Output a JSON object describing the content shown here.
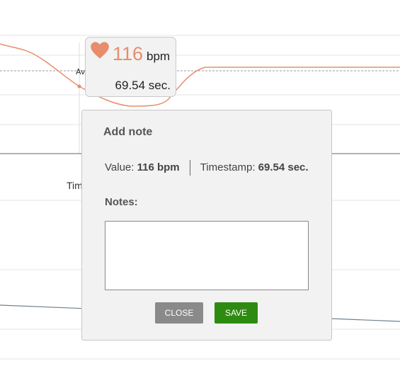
{
  "chart": {
    "average_label": "Average",
    "x_axis_title": "Time (sec.)",
    "line_color": "#e88d6b",
    "lower_line_color": "#6e8290"
  },
  "tooltip": {
    "icon": "heart-icon",
    "value": "116",
    "unit": "bpm",
    "timestamp": "69.54 sec."
  },
  "dialog": {
    "title": "Add note",
    "value_label": "Value:",
    "value": "116 bpm",
    "timestamp_label": "Timestamp:",
    "timestamp": "69.54 sec.",
    "notes_label": "Notes:",
    "notes_value": "",
    "close_label": "CLOSE",
    "save_label": "SAVE",
    "close_color": "#8a8a8a",
    "save_color": "#2e8b12"
  }
}
